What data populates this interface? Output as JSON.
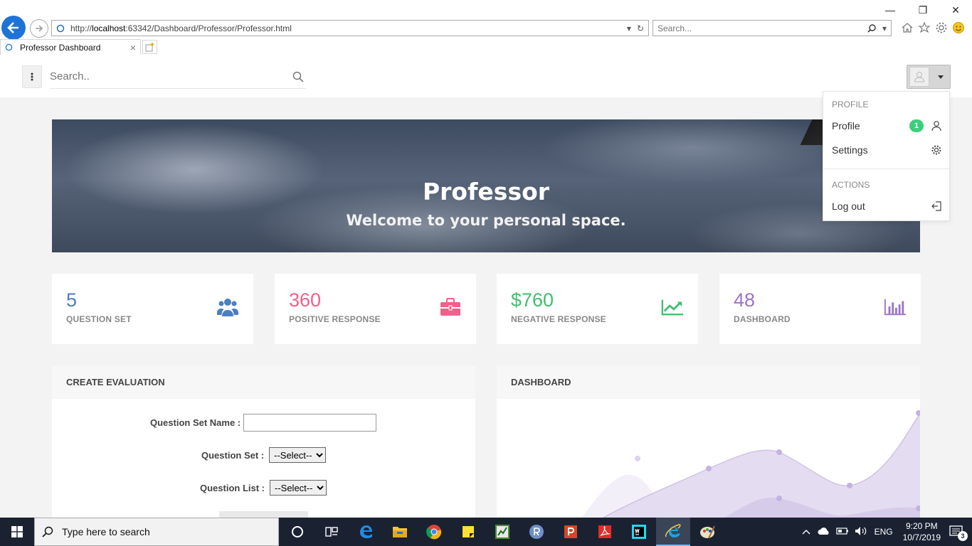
{
  "browser": {
    "url_prefix": "http://",
    "url_host": "localhost",
    "url_rest": ":63342/Dashboard/Professor/Professor.html",
    "search_placeholder": "Search...",
    "tab_title": "Professor Dashboard",
    "tab_close": "×"
  },
  "window_controls": {
    "minimize": "—",
    "restore": "❐",
    "close": "✕"
  },
  "topbar": {
    "search_placeholder": "Search.."
  },
  "hero": {
    "title": "Professor",
    "subtitle": "Welcome to your personal space."
  },
  "stats": [
    {
      "value": "5",
      "label": "QUESTION SET",
      "color": "#4a7fc1",
      "icon": "users-icon"
    },
    {
      "value": "360",
      "label": "POSITIVE RESPONSE",
      "color": "#f0608a",
      "icon": "briefcase-icon"
    },
    {
      "value": "$760",
      "label": "NEGATIVE RESPONSE",
      "color": "#3fbf6f",
      "icon": "trend-up-icon"
    },
    {
      "value": "48",
      "label": "DASHBOARD",
      "color": "#9b74c8",
      "icon": "bar-chart-icon"
    }
  ],
  "evaluation": {
    "title": "CREATE EVALUATION",
    "qset_name_label": "Question Set Name :",
    "qset_label": "Question Set :",
    "qset_value": "--Select--",
    "qlist_label": "Question List :",
    "qlist_value": "--Select--"
  },
  "dashboard_panel": {
    "title": "DASHBOARD"
  },
  "dropdown": {
    "profile_header": "PROFILE",
    "profile": "Profile",
    "profile_badge": "1",
    "settings": "Settings",
    "actions_header": "ACTIONS",
    "logout": "Log out"
  },
  "taskbar": {
    "search_placeholder": "Type here to search",
    "language": "ENG",
    "time": "9:20 PM",
    "date": "10/7/2019",
    "notifications": "3"
  },
  "colors": {
    "accent_blue": "#1e73d6",
    "badge_green": "#3ccf7a",
    "chart_fill": "#e4dcf0",
    "chart_point": "#c4b2e0"
  }
}
